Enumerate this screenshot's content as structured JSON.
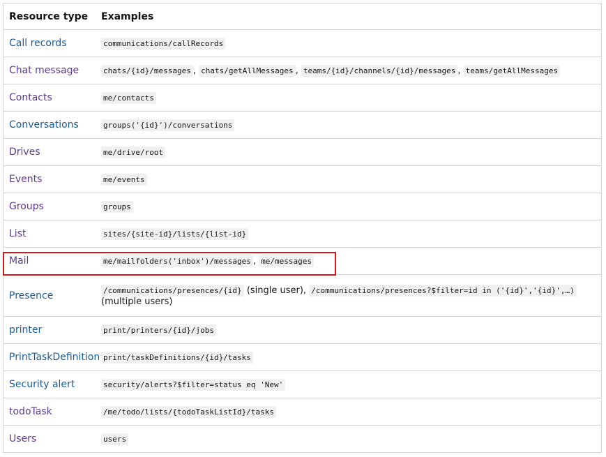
{
  "headers": {
    "resource_type": "Resource type",
    "examples": "Examples"
  },
  "rows": [
    {
      "resource": "Call records",
      "link_color": "blue",
      "parts": [
        {
          "t": "code",
          "v": "communications/callRecords"
        }
      ]
    },
    {
      "resource": "Chat message",
      "link_color": "purple",
      "parts": [
        {
          "t": "code",
          "v": "chats/{id}/messages"
        },
        {
          "t": "text",
          "v": ", "
        },
        {
          "t": "code",
          "v": "chats/getAllMessages"
        },
        {
          "t": "text",
          "v": ", "
        },
        {
          "t": "code",
          "v": "teams/{id}/channels/{id}/messages"
        },
        {
          "t": "text",
          "v": ", "
        },
        {
          "t": "code",
          "v": "teams/getAllMessages"
        }
      ]
    },
    {
      "resource": "Contacts",
      "link_color": "purple",
      "parts": [
        {
          "t": "code",
          "v": "me/contacts"
        }
      ]
    },
    {
      "resource": "Conversations",
      "link_color": "blue",
      "parts": [
        {
          "t": "code",
          "v": "groups('{id}')/conversations"
        }
      ]
    },
    {
      "resource": "Drives",
      "link_color": "purple",
      "parts": [
        {
          "t": "code",
          "v": "me/drive/root"
        }
      ]
    },
    {
      "resource": "Events",
      "link_color": "purple",
      "parts": [
        {
          "t": "code",
          "v": "me/events"
        }
      ]
    },
    {
      "resource": "Groups",
      "link_color": "purple",
      "parts": [
        {
          "t": "code",
          "v": "groups"
        }
      ]
    },
    {
      "resource": "List",
      "link_color": "purple",
      "parts": [
        {
          "t": "code",
          "v": "sites/{site-id}/lists/{list-id}"
        }
      ]
    },
    {
      "resource": "Mail",
      "link_color": "purple",
      "highlighted": true,
      "parts": [
        {
          "t": "code",
          "v": "me/mailfolders('inbox')/messages"
        },
        {
          "t": "text",
          "v": ", "
        },
        {
          "t": "code",
          "v": "me/messages"
        }
      ]
    },
    {
      "resource": "Presence",
      "link_color": "blue",
      "tall": true,
      "parts": [
        {
          "t": "code",
          "v": "/communications/presences/{id}"
        },
        {
          "t": "text",
          "v": " (single user), "
        },
        {
          "t": "code",
          "v": "/communications/presences?$filter=id in ('{id}','{id}',…)"
        },
        {
          "t": "text",
          "v": " (multiple users)"
        }
      ]
    },
    {
      "resource": "printer",
      "link_color": "blue",
      "parts": [
        {
          "t": "code",
          "v": "print/printers/{id}/jobs"
        }
      ]
    },
    {
      "resource": "PrintTaskDefinition",
      "link_color": "blue",
      "parts": [
        {
          "t": "code",
          "v": "print/taskDefinitions/{id}/tasks"
        }
      ]
    },
    {
      "resource": "Security alert",
      "link_color": "blue",
      "parts": [
        {
          "t": "code",
          "v": "security/alerts?$filter=status eq 'New'"
        }
      ]
    },
    {
      "resource": "todoTask",
      "link_color": "purple",
      "parts": [
        {
          "t": "code",
          "v": "/me/todo/lists/{todoTaskListId}/tasks"
        }
      ]
    },
    {
      "resource": "Users",
      "link_color": "purple",
      "parts": [
        {
          "t": "code",
          "v": "users"
        }
      ]
    }
  ],
  "colors": {
    "link_blue": "#1a5c9a",
    "link_purple": "#5c3b8c",
    "highlight_border": "#d11a1a",
    "code_bg": "#f0f0f0",
    "border": "#d4d4d4"
  }
}
